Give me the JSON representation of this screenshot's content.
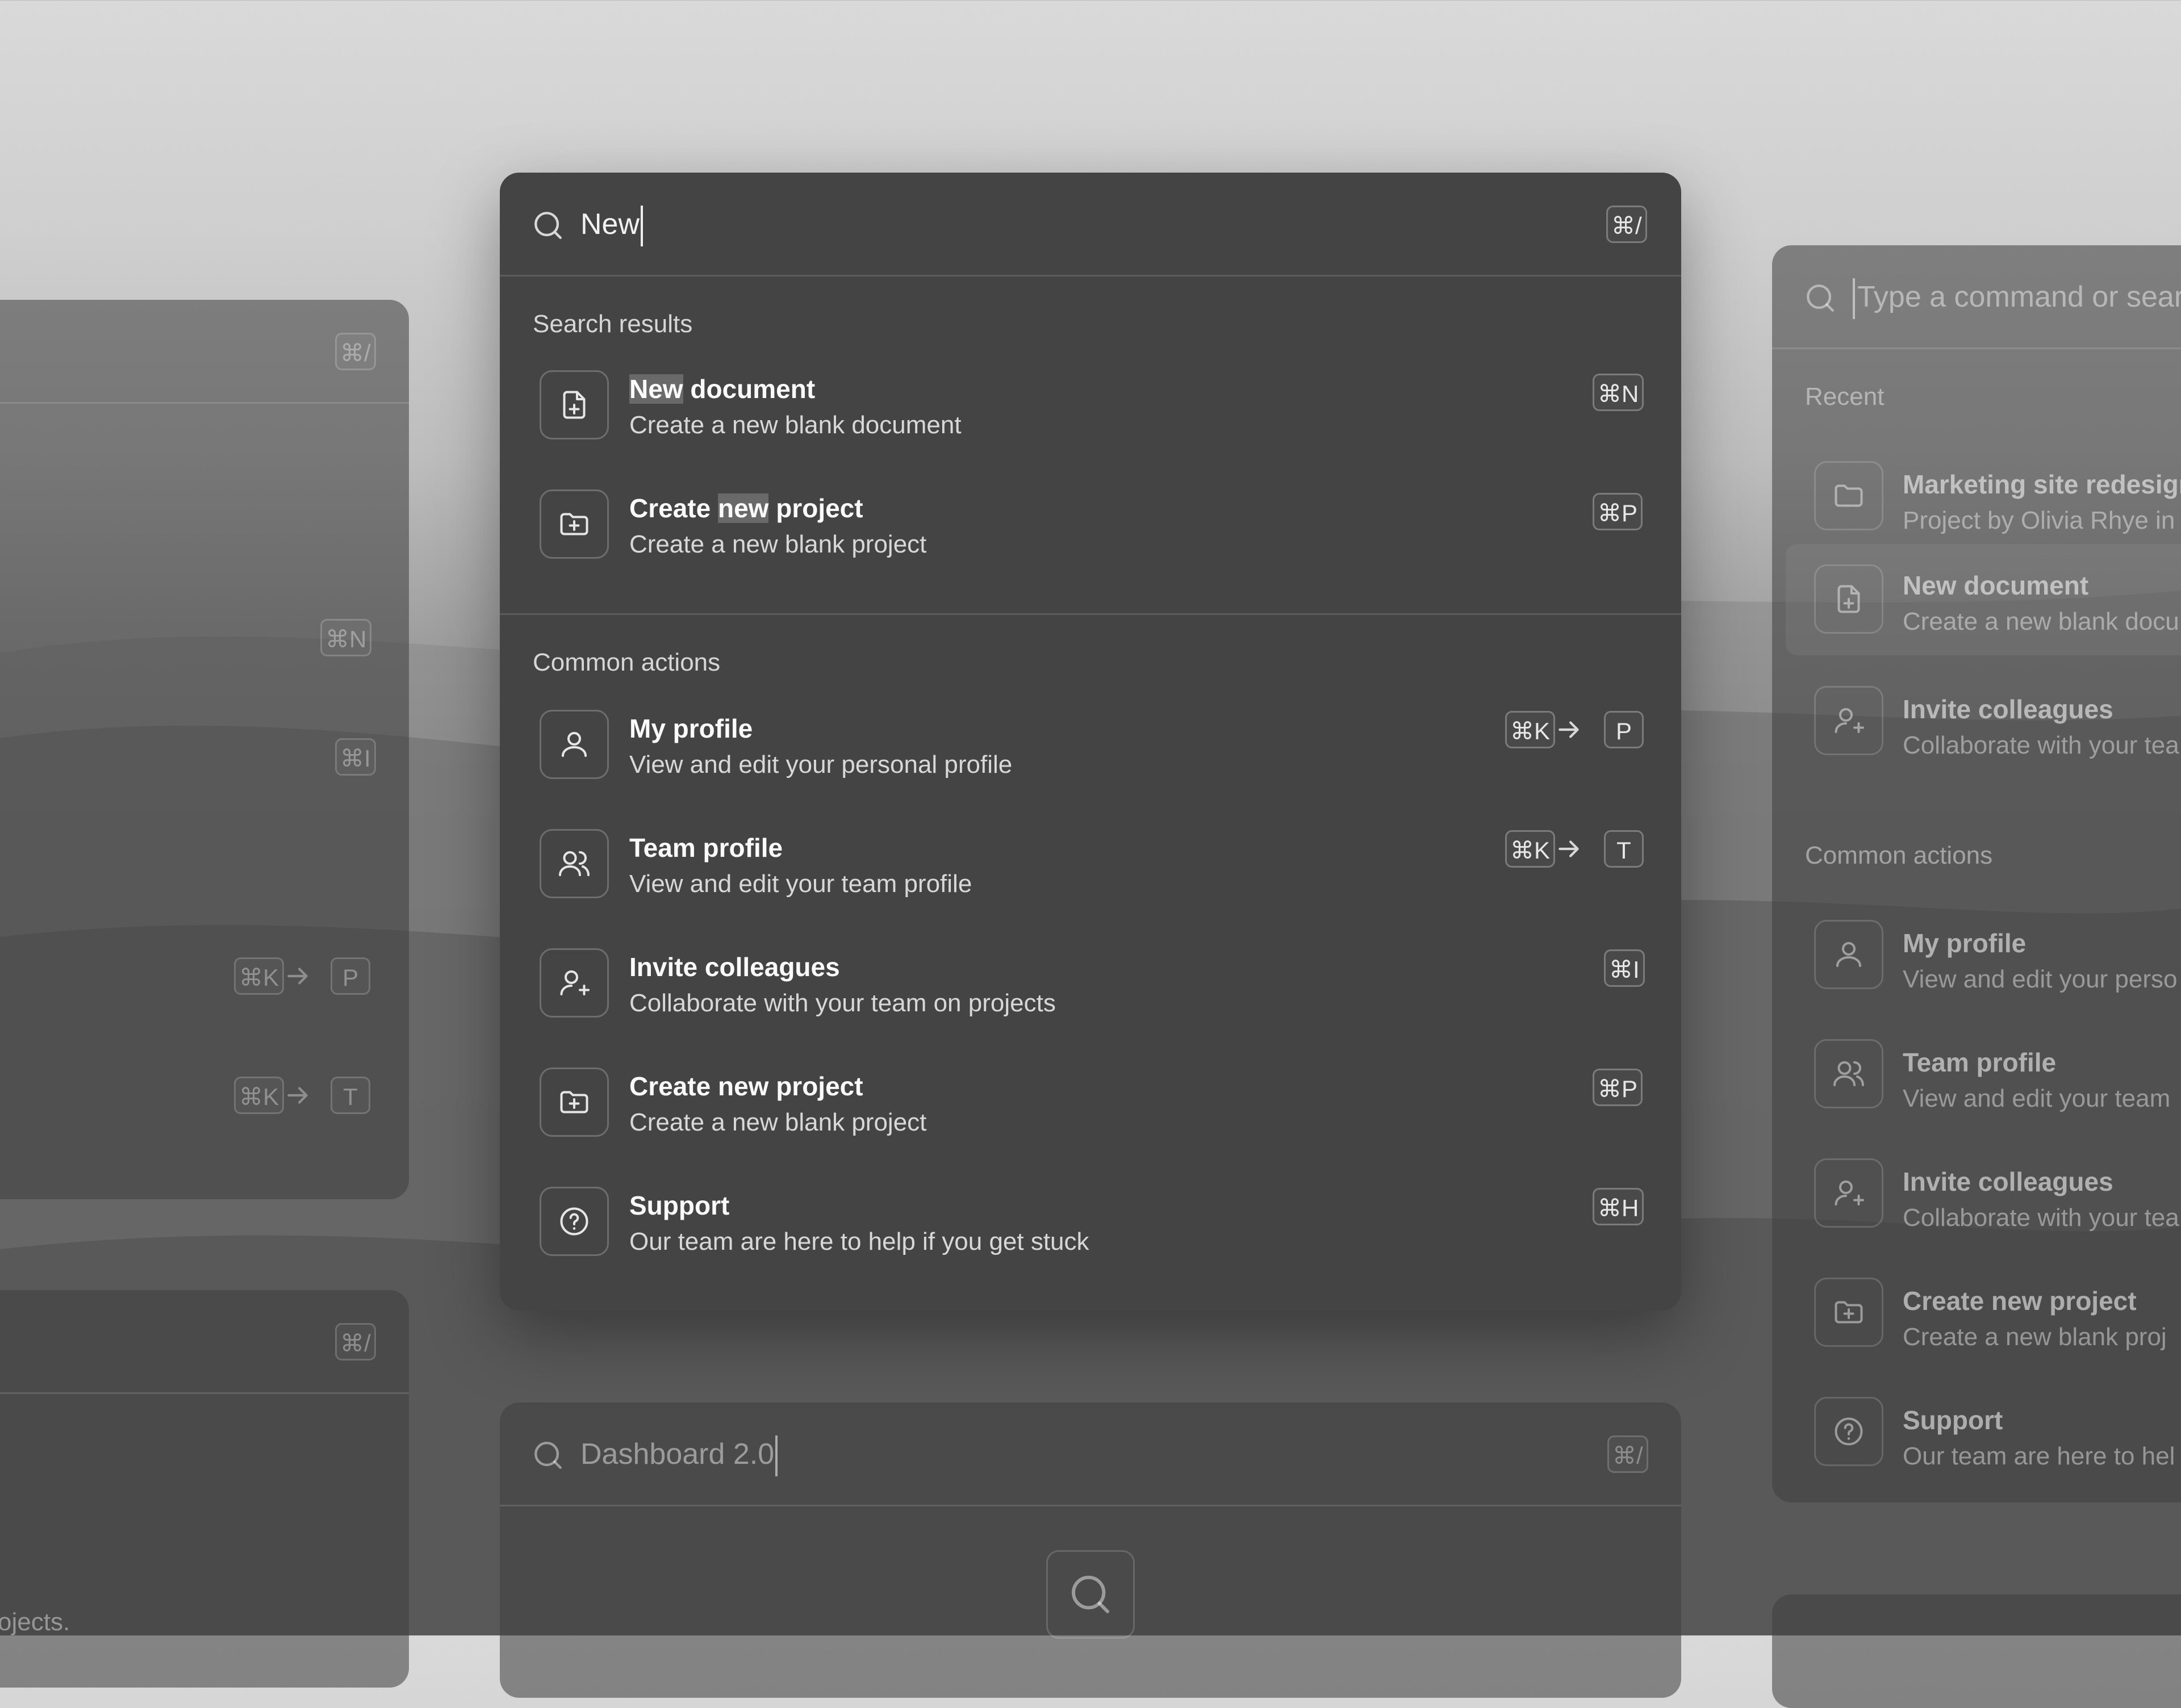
{
  "main": {
    "query": "New",
    "shortcut": "⌘/",
    "section_results": "Search results",
    "section_common": "Common actions",
    "results": [
      {
        "title_pre": "",
        "title_hl": "New",
        "title_post": " document",
        "desc": "Create a new blank document",
        "shortcut": "⌘N",
        "icon": "file-plus-icon"
      },
      {
        "title_pre": "Create ",
        "title_hl": "new",
        "title_post": " project",
        "desc": "Create a new blank project",
        "shortcut": "⌘P",
        "icon": "folder-plus-icon"
      }
    ],
    "actions": [
      {
        "title": "My profile",
        "desc": "View and edit your personal profile",
        "keys": [
          "⌘K",
          "P"
        ],
        "icon": "user-icon"
      },
      {
        "title": "Team profile",
        "desc": "View and edit your team profile",
        "keys": [
          "⌘K",
          "T"
        ],
        "icon": "users-icon"
      },
      {
        "title": "Invite colleagues",
        "desc": "Collaborate with your team on projects",
        "keys": [
          "⌘I"
        ],
        "icon": "user-plus-icon"
      },
      {
        "title": "Create new project",
        "desc": "Create a new blank project",
        "keys": [
          "⌘P"
        ],
        "icon": "folder-plus-icon"
      },
      {
        "title": "Support",
        "desc": "Our team are here to help if you get stuck",
        "keys": [
          "⌘H"
        ],
        "icon": "help-circle-icon"
      }
    ]
  },
  "right": {
    "placeholder": "Type a command or sear",
    "section_recent": "Recent",
    "section_common": "Common actions",
    "recent": [
      {
        "title": "Marketing site redesign",
        "desc": "Project by Olivia Rhye in"
      },
      {
        "title": "New document",
        "desc": "Create a new blank docu"
      },
      {
        "title": "Invite colleagues",
        "desc": "Collaborate with your tea"
      }
    ],
    "actions": [
      {
        "title": "My profile",
        "desc": "View and edit your perso"
      },
      {
        "title": "Team profile",
        "desc": "View and edit your team"
      },
      {
        "title": "Invite colleagues",
        "desc": "Collaborate with your tea"
      },
      {
        "title": "Create new project",
        "desc": "Create a new blank proj"
      },
      {
        "title": "Support",
        "desc": "Our team are here to hel"
      }
    ]
  },
  "left": {
    "shortcut": "⌘/",
    "keys": [
      "⌘N",
      "⌘I",
      "⌘K",
      "P",
      "⌘K",
      "T"
    ],
    "bottom_shortcut": "⌘/",
    "bottom_text": "ojects."
  },
  "bottom": {
    "query": "Dashboard 2.0",
    "shortcut": "⌘/"
  }
}
